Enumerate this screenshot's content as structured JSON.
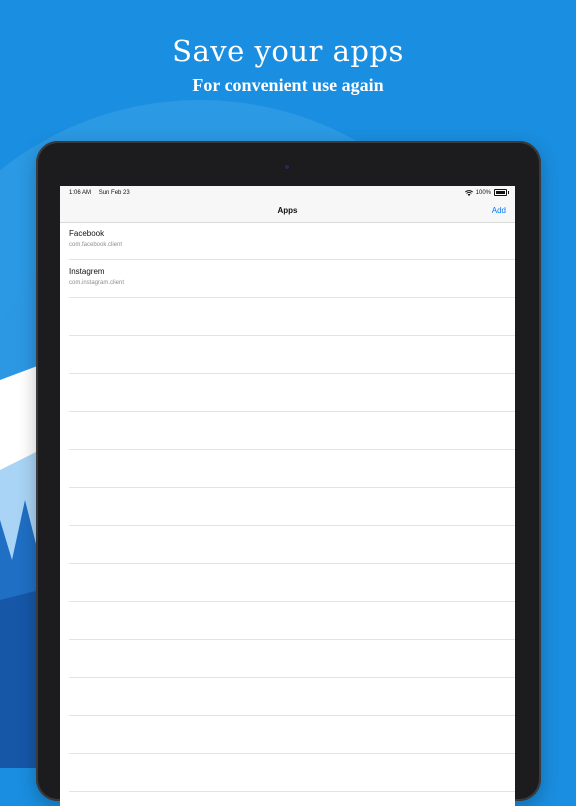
{
  "promo": {
    "headline": "Save your apps",
    "subheadline": "For convenient use again"
  },
  "status_bar": {
    "time": "1:06 AM",
    "date": "Sun Feb 23",
    "battery": "100%"
  },
  "nav": {
    "title": "Apps",
    "add_label": "Add"
  },
  "apps": [
    {
      "name": "Facebook",
      "bundle_id": "com.facebook.client"
    },
    {
      "name": "Instagrem",
      "bundle_id": "com.instagram.client"
    }
  ],
  "empty_row_count": 13,
  "colors": {
    "background": "#1a8ee0",
    "accent": "#007aff",
    "device_frame": "#1c1c1e"
  },
  "icons": [
    "wifi-icon",
    "battery-icon",
    "camera-icon"
  ]
}
